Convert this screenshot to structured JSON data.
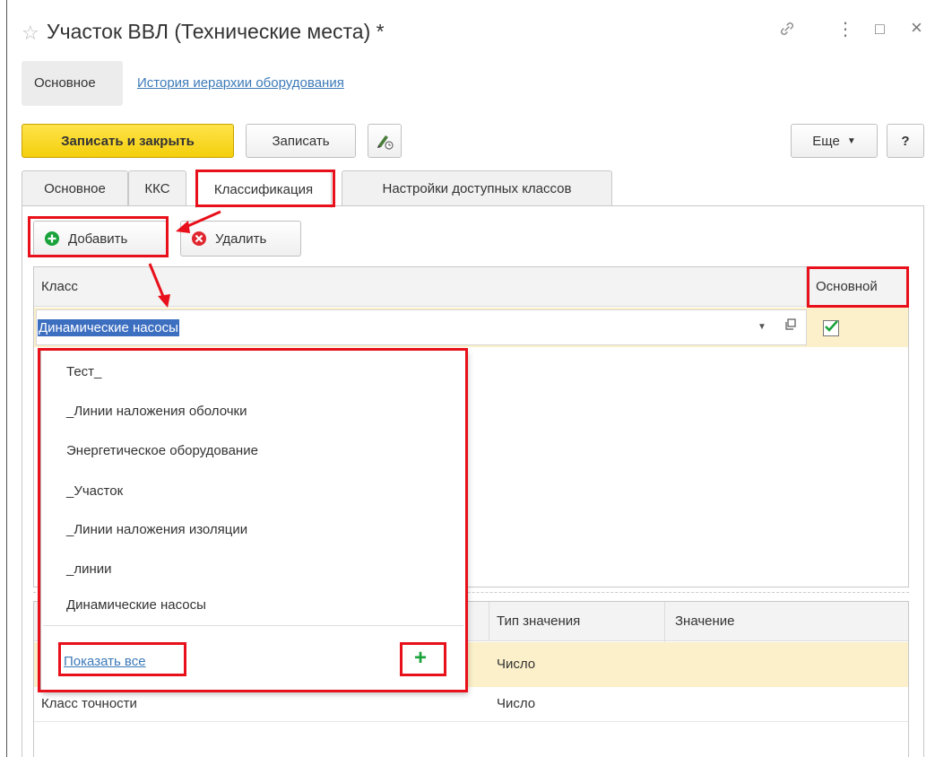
{
  "window": {
    "title": "Участок ВВЛ (Технические места) *",
    "star_icon": "☆",
    "link_icon": "🔗",
    "menu_icon": "⋮",
    "maximize_icon": "□",
    "close_icon": "×"
  },
  "page_links": {
    "main": "Основное",
    "history": "История иерархии оборудования"
  },
  "toolbar": {
    "save_close": "Записать и закрыть",
    "save": "Записать",
    "more": "Еще",
    "help": "?"
  },
  "tabs": [
    {
      "label": "Основное"
    },
    {
      "label": "ККС"
    },
    {
      "label": "Классификация"
    },
    {
      "label": "Настройки доступных классов"
    }
  ],
  "class_toolbar": {
    "add": "Добавить",
    "delete": "Удалить"
  },
  "class_table": {
    "columns": [
      "Класс",
      "Основной"
    ],
    "rows": [
      {
        "class": "Динамические насосы",
        "main": true
      }
    ]
  },
  "dropdown": {
    "items": [
      "Тест_",
      "_Линии наложения оболочки",
      "Энергетическое оборудование",
      "_Участок",
      "_Линии наложения изоляции",
      "_линии",
      "Динамические насосы"
    ],
    "show_all": "Показать все",
    "add_symbol": "+"
  },
  "props_table": {
    "columns": [
      "Тип значения",
      "Значение"
    ],
    "rows": [
      {
        "name": "",
        "type": "Число",
        "value": ""
      },
      {
        "name": "Класс точности",
        "type": "Число",
        "value": ""
      }
    ]
  },
  "colors": {
    "accent_yellow": "#f4cf0c",
    "highlight_red": "#e8101a",
    "selection_blue": "#3d6fc1",
    "row_selected": "#fbf0c9",
    "link_blue": "#3d7ab8",
    "green": "#1aa33b"
  }
}
